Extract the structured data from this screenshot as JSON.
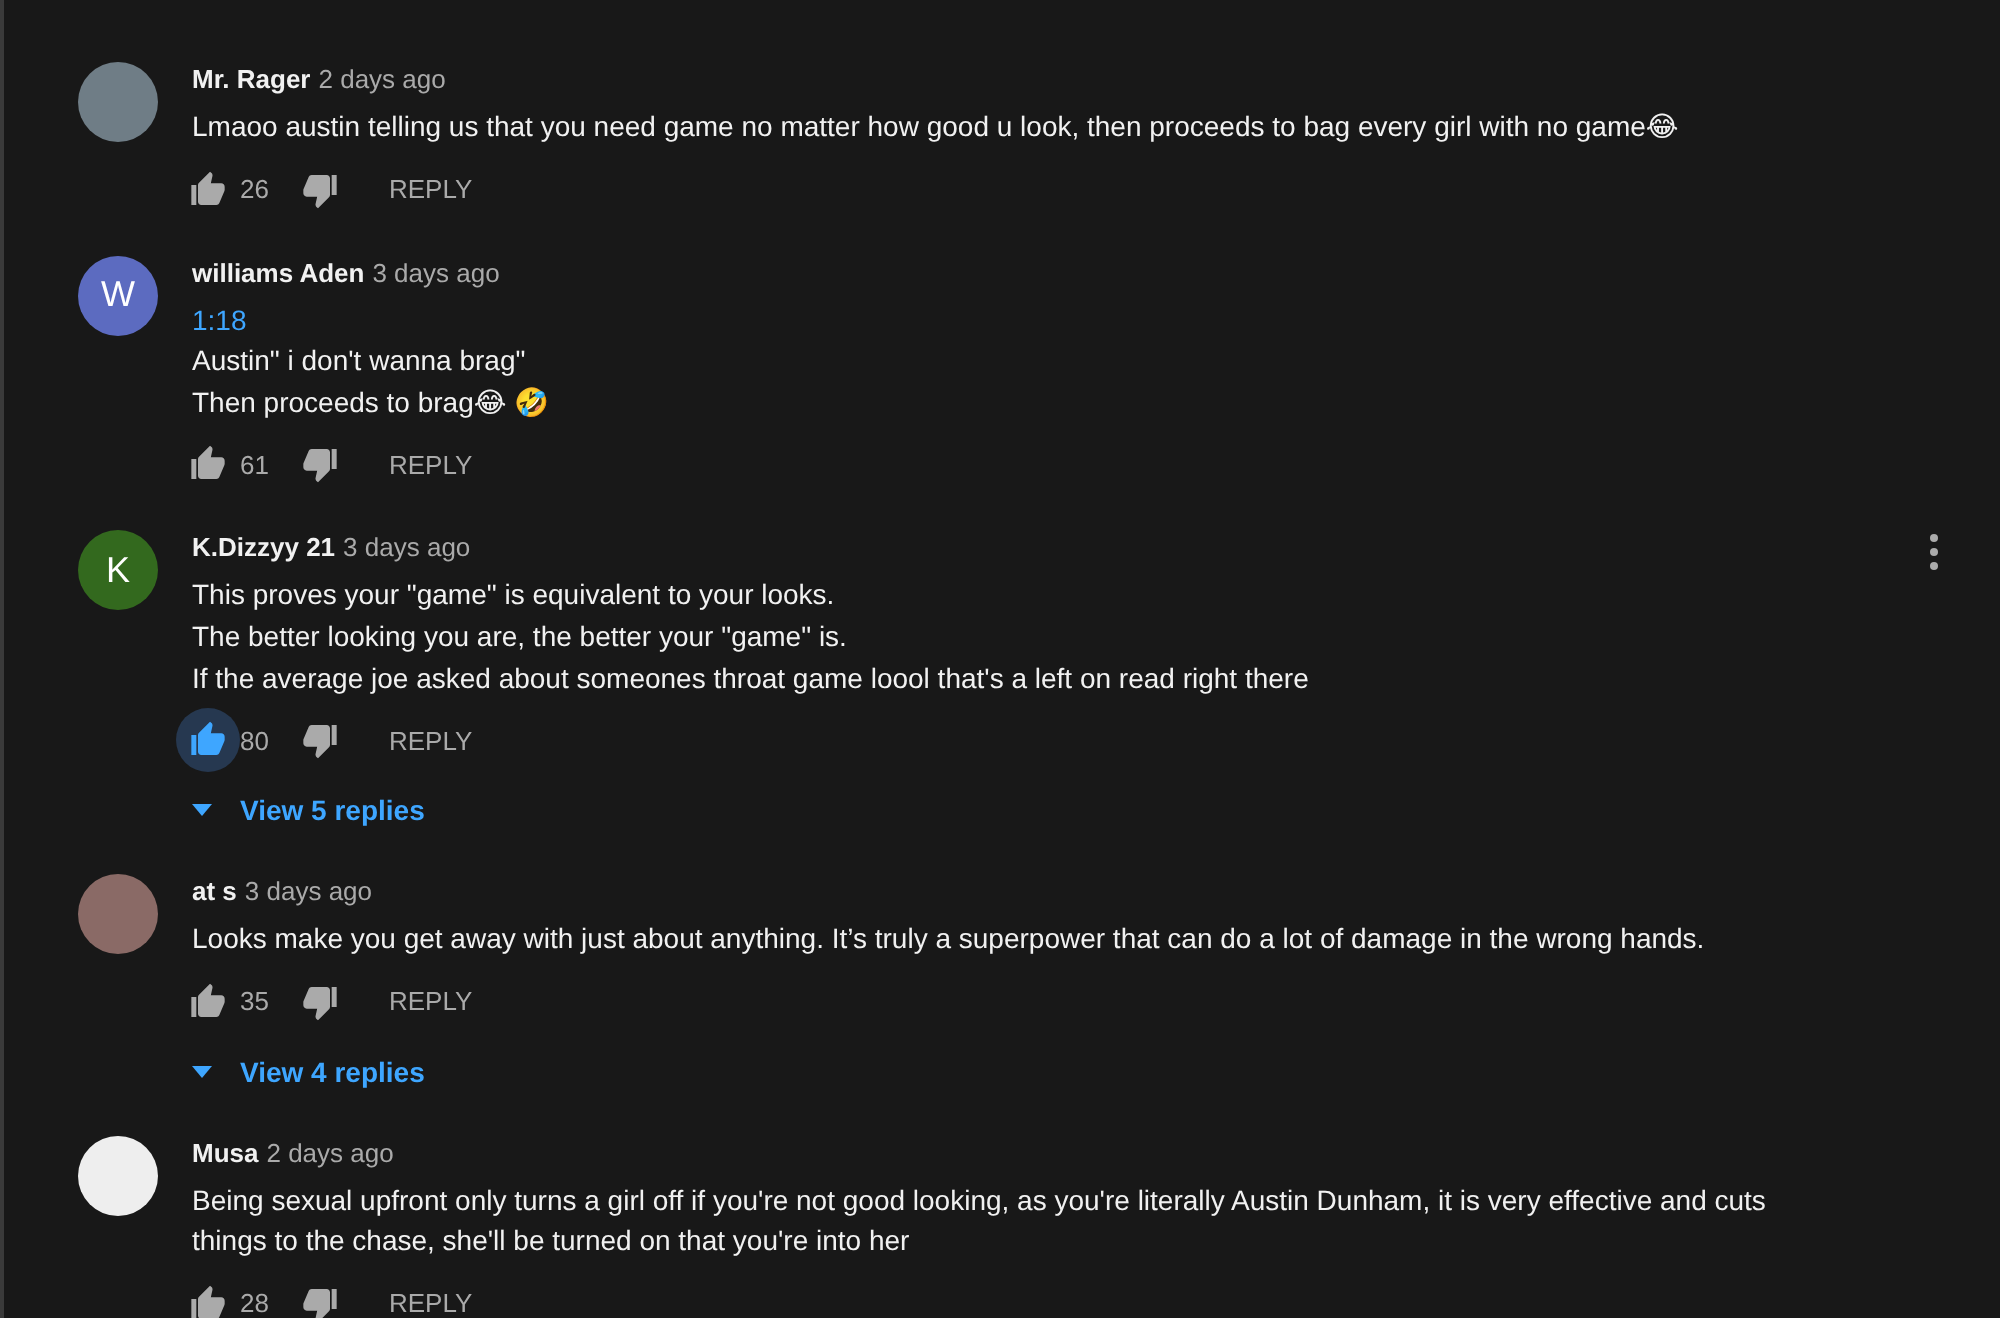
{
  "comments": [
    {
      "author": "Mr. Rager",
      "time": "2 days ago",
      "avatar": {
        "kind": "image",
        "color": "#6f7d86"
      },
      "menu": false,
      "lines": [
        {
          "kind": "text",
          "text": "Lmaoo austin telling us that you need game no matter how good u look, then proceeds to bag every girl with no game😂"
        }
      ],
      "likes": "26",
      "liked": false,
      "reply_label": "REPLY"
    },
    {
      "author": "williams Aden",
      "time": "3 days ago",
      "avatar": {
        "kind": "letter",
        "letter": "W",
        "color": "#5c6bc0"
      },
      "menu": false,
      "lines": [
        {
          "kind": "timestamp",
          "text": "1:18"
        },
        {
          "kind": "text",
          "text": "Austin\" i don't wanna brag\""
        },
        {
          "kind": "text",
          "text": "Then proceeds to brag😂 🤣"
        }
      ],
      "likes": "61",
      "liked": false,
      "reply_label": "REPLY"
    },
    {
      "author": "K.Dizzyy 21",
      "time": "3 days ago",
      "avatar": {
        "kind": "letter",
        "letter": "K",
        "color": "#33691e"
      },
      "menu": true,
      "lines": [
        {
          "kind": "text",
          "text": "This proves your \"game\" is equivalent to your looks."
        },
        {
          "kind": "text",
          "text": "The better looking you are, the better your \"game\" is."
        },
        {
          "kind": "text",
          "text": "If the average joe asked about someones throat game loool that's a left on read right there"
        }
      ],
      "likes": "80",
      "liked": true,
      "reply_label": "REPLY",
      "view_replies": "View 5 replies"
    },
    {
      "author": "at s",
      "time": "3 days ago",
      "avatar": {
        "kind": "image",
        "color": "#8a6a66"
      },
      "menu": false,
      "lines": [
        {
          "kind": "text",
          "text": "Looks make you get away with just about anything. It’s truly a superpower that can do a lot of damage in the wrong hands."
        }
      ],
      "likes": "35",
      "liked": false,
      "reply_label": "REPLY",
      "view_replies": "View 4 replies"
    },
    {
      "author": "Musa",
      "time": "2 days ago",
      "avatar": {
        "kind": "image",
        "color": "#eeeeee"
      },
      "menu": false,
      "lines": [
        {
          "kind": "text",
          "text": "Being sexual upfront only turns a girl off if you're not good looking, as you're literally Austin Dunham, it is very effective and cuts things to the chase, she'll be turned on that you're into her"
        }
      ],
      "likes": "28",
      "liked": false,
      "reply_label": "REPLY"
    }
  ]
}
